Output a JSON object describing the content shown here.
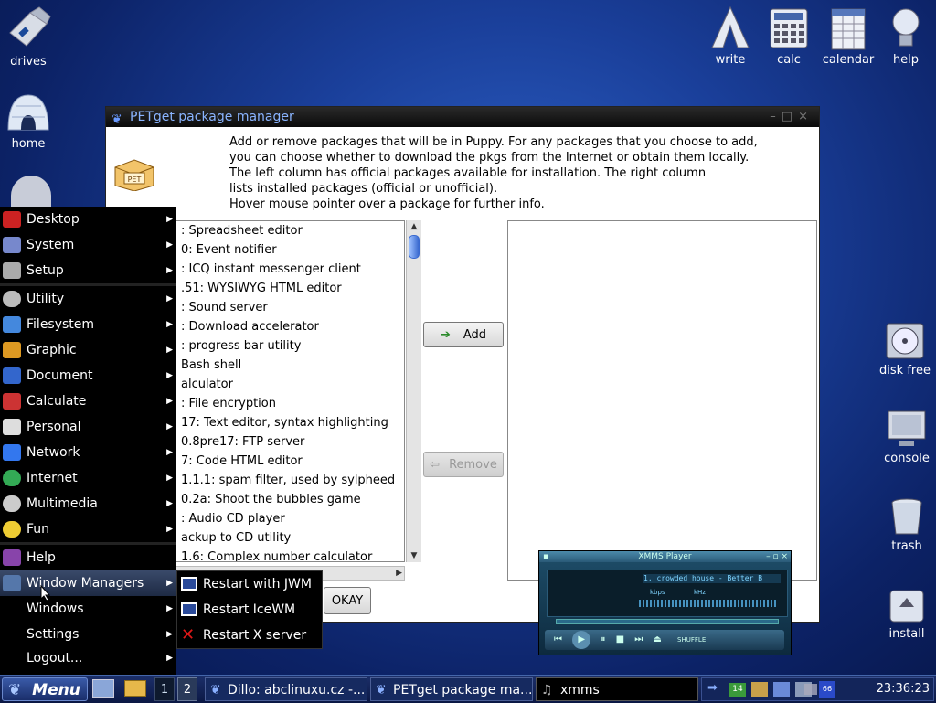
{
  "desktop_icons": {
    "drives": "drives",
    "home": "home",
    "write": "write",
    "calc": "calc",
    "calendar": "calendar",
    "help": "help",
    "disk_free": "disk free",
    "console": "console",
    "trash": "trash",
    "install": "install"
  },
  "window": {
    "title": "PETget package manager",
    "description": [
      "Add or remove packages that will be in Puppy. For any packages that you choose to add,",
      "you can choose whether to download the pkgs from the Internet or obtain them locally.",
      "The left column has official packages available for installation. The right column",
      "lists installed packages (official or unofficial).",
      "Hover mouse pointer over a package for further info."
    ],
    "packages": [
      ": Spreadsheet editor",
      "0: Event notifier",
      ": ICQ instant messenger client",
      ".51: WYSIWYG HTML editor",
      ": Sound server",
      ": Download accelerator",
      ": progress bar utility",
      "Bash shell",
      "alculator",
      ": File encryption",
      "17: Text editor, syntax highlighting",
      "0.8pre17: FTP server",
      "7: Code HTML editor",
      "1.1.1: spam filter, used by sylpheed",
      "0.2a: Shoot the bubbles game",
      ": Audio CD player",
      "ackup to CD utility",
      "1.6: Complex number calculator"
    ],
    "add_label": "Add",
    "remove_label": "Remove",
    "okay_label": "OKAY"
  },
  "menu": {
    "items": [
      {
        "label": "Desktop",
        "color": "#cc2222"
      },
      {
        "label": "System",
        "color": "#7788cc"
      },
      {
        "label": "Setup",
        "color": "#aaaaaa"
      },
      {
        "label": "Utility",
        "color": "#bbbbbb"
      },
      {
        "label": "Filesystem",
        "color": "#4488dd"
      },
      {
        "label": "Graphic",
        "color": "#dd9922"
      },
      {
        "label": "Document",
        "color": "#3366cc"
      },
      {
        "label": "Calculate",
        "color": "#cc3333"
      },
      {
        "label": "Personal",
        "color": "#dddddd"
      },
      {
        "label": "Network",
        "color": "#3377ee"
      },
      {
        "label": "Internet",
        "color": "#33aa55"
      },
      {
        "label": "Multimedia",
        "color": "#cccccc"
      },
      {
        "label": "Fun",
        "color": "#eecc33"
      },
      {
        "label": "Help",
        "color": "#8844aa"
      },
      {
        "label": "Window Managers",
        "color": "#5577aa"
      },
      {
        "label": "Windows",
        "color": "#000000"
      },
      {
        "label": "Settings",
        "color": "#000000"
      },
      {
        "label": "Logout...",
        "color": "#000000"
      }
    ]
  },
  "submenu": {
    "items": [
      "Restart with JWM",
      "Restart IceWM",
      "Restart X server"
    ]
  },
  "taskbar": {
    "menu_label": "Menu",
    "workspace_1": "1",
    "workspace_2": "2",
    "task_dillo": "Dillo: abclinuxu.cz -...",
    "task_petget": "PETget package ma...",
    "task_xmms": "xmms",
    "tray_date": "14",
    "tray_66": "66",
    "clock": "23:36:23"
  },
  "xmms": {
    "title": "XMMS Player",
    "track": "1. crowded house - Better B",
    "kbps": "kbps",
    "khz": "kHz",
    "shuffle": "SHUFFLE"
  }
}
